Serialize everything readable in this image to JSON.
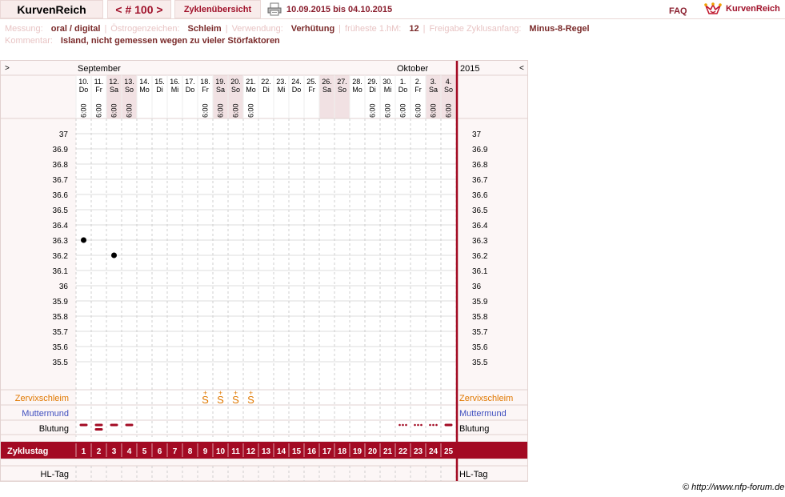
{
  "header": {
    "app_title": "KurvenReich",
    "cycle_nav": "< # 100 >",
    "cycles_tab": "Zyklenübersicht",
    "date_range": "10.09.2015 bis 04.10.2015",
    "faq": "FAQ",
    "logo_text": "KurvenReich",
    "print_icon": "printer-icon",
    "logo_icon": "crown-icon"
  },
  "info": {
    "measurement_label": "Messung:",
    "measurement_value": "oral / digital",
    "estrogen_label": "Östrogenzeichen:",
    "estrogen_value": "Schleim",
    "usage_label": "Verwendung:",
    "usage_value": "Verhütung",
    "earliest_label": "früheste 1.hM:",
    "earliest_value": "12",
    "release_label": "Freigabe Zyklusanfang:",
    "release_value": "Minus-8-Regel",
    "comment_label": "Kommentar:",
    "comment_value": "Island, nicht gemessen wegen zu vieler Störfaktoren"
  },
  "chart_data": {
    "type": "scatter",
    "year": "2015",
    "nav_prev": ">",
    "nav_next": "<",
    "months": [
      "September",
      "Oktober"
    ],
    "days": [
      {
        "date": "10.",
        "wd": "Do",
        "time": "6:00",
        "weekend": false
      },
      {
        "date": "11.",
        "wd": "Fr",
        "time": "6:00",
        "weekend": false
      },
      {
        "date": "12.",
        "wd": "Sa",
        "time": "6:00",
        "weekend": true
      },
      {
        "date": "13.",
        "wd": "So",
        "time": "6:00",
        "weekend": true
      },
      {
        "date": "14.",
        "wd": "Mo",
        "time": "",
        "weekend": false
      },
      {
        "date": "15.",
        "wd": "Di",
        "time": "",
        "weekend": false
      },
      {
        "date": "16.",
        "wd": "Mi",
        "time": "",
        "weekend": false
      },
      {
        "date": "17.",
        "wd": "Do",
        "time": "",
        "weekend": false
      },
      {
        "date": "18.",
        "wd": "Fr",
        "time": "6:00",
        "weekend": false
      },
      {
        "date": "19.",
        "wd": "Sa",
        "time": "6:00",
        "weekend": true
      },
      {
        "date": "20.",
        "wd": "So",
        "time": "6:00",
        "weekend": true
      },
      {
        "date": "21.",
        "wd": "Mo",
        "time": "6:00",
        "weekend": false
      },
      {
        "date": "22.",
        "wd": "Di",
        "time": "",
        "weekend": false
      },
      {
        "date": "23.",
        "wd": "Mi",
        "time": "",
        "weekend": false
      },
      {
        "date": "24.",
        "wd": "Do",
        "time": "",
        "weekend": false
      },
      {
        "date": "25.",
        "wd": "Fr",
        "time": "",
        "weekend": false
      },
      {
        "date": "26.",
        "wd": "Sa",
        "time": "",
        "weekend": true
      },
      {
        "date": "27.",
        "wd": "So",
        "time": "",
        "weekend": true
      },
      {
        "date": "28.",
        "wd": "Mo",
        "time": "",
        "weekend": false
      },
      {
        "date": "29.",
        "wd": "Di",
        "time": "6:00",
        "weekend": false
      },
      {
        "date": "30.",
        "wd": "Mi",
        "time": "6:00",
        "weekend": false
      },
      {
        "date": "1.",
        "wd": "Do",
        "time": "6:00",
        "weekend": false
      },
      {
        "date": "2.",
        "wd": "Fr",
        "time": "6:00",
        "weekend": false
      },
      {
        "date": "3.",
        "wd": "Sa",
        "time": "6:00",
        "weekend": true
      },
      {
        "date": "4.",
        "wd": "So",
        "time": "6:00",
        "weekend": true
      }
    ],
    "ylim": [
      35.5,
      37.0
    ],
    "y_ticks": [
      "37",
      "36.9",
      "36.8",
      "36.7",
      "36.6",
      "36.5",
      "36.4",
      "36.3",
      "36.2",
      "36.1",
      "36",
      "35.9",
      "35.8",
      "35.7",
      "35.6",
      "35.5"
    ],
    "temperatures": [
      {
        "day": 1,
        "value": 36.3
      },
      {
        "day": 3,
        "value": 36.2
      }
    ],
    "rows": {
      "cervical": "Zervixschleim",
      "cervix": "Muttermund",
      "bleeding": "Blutung",
      "cycle_day": "Zyklustag",
      "hl_day": "HL-Tag"
    },
    "cervical_days": [
      9,
      10,
      11,
      12
    ],
    "cervical_symbol": "S+",
    "bleeding": [
      {
        "day": 1,
        "level": "medium"
      },
      {
        "day": 2,
        "level": "heavy"
      },
      {
        "day": 3,
        "level": "medium"
      },
      {
        "day": 4,
        "level": "medium"
      },
      {
        "day": 22,
        "level": "spotting"
      },
      {
        "day": 23,
        "level": "spotting"
      },
      {
        "day": 24,
        "level": "spotting"
      },
      {
        "day": 25,
        "level": "medium"
      }
    ],
    "colors": {
      "accent": "#a30a23",
      "cervical": "#e07800",
      "cervix": "#3f4fbf",
      "weekend_shade": "#f1e1e3",
      "grid": "#dddddd",
      "panel_bg": "#fcf6f6"
    }
  },
  "footer": {
    "copyright": "© http://www.nfp-forum.de"
  }
}
